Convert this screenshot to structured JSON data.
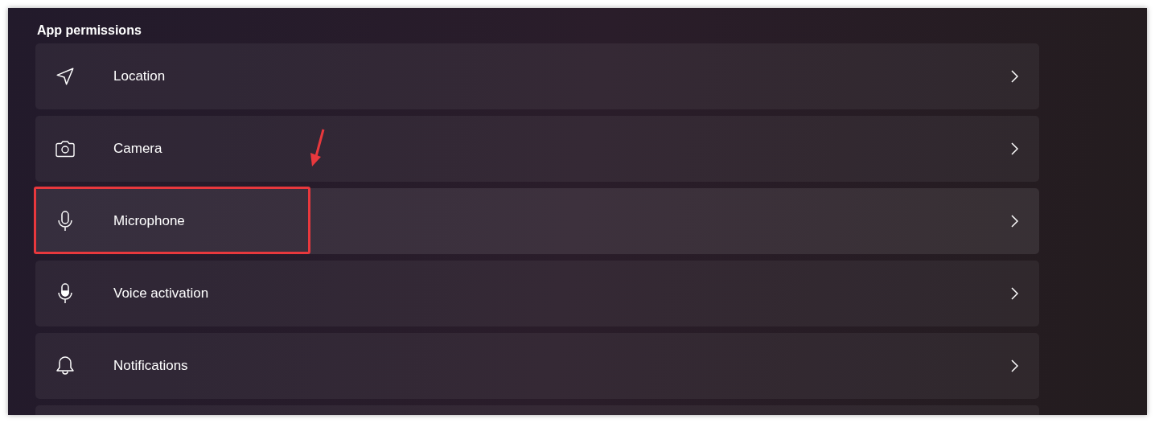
{
  "section": {
    "title": "App permissions"
  },
  "items": [
    {
      "label": "Location",
      "kind": "location",
      "hovered": false,
      "marked": false
    },
    {
      "label": "Camera",
      "kind": "camera",
      "hovered": false,
      "marked": false
    },
    {
      "label": "Microphone",
      "kind": "microphone",
      "hovered": true,
      "marked": true
    },
    {
      "label": "Voice activation",
      "kind": "voice",
      "hovered": false,
      "marked": false
    },
    {
      "label": "Notifications",
      "kind": "notifications",
      "hovered": false,
      "marked": false
    }
  ]
}
